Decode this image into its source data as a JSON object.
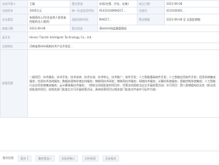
{
  "table": {
    "labels": {
      "name": "法定代表人",
      "status": "登记状态",
      "reg_capital": "注册资本",
      "date": "成立日期",
      "credit_code": "统一社会信用代码",
      "reg_no": "注册号",
      "org_code": "组织机构代码",
      "type": "企业类型",
      "term": "营业期限",
      "audit": "核准日期",
      "region": "登记机关",
      "english": "英文名",
      "address": "注册地址",
      "scope": "经营范围"
    },
    "values": {
      "name": "王磊",
      "status": "存续(在营、开业、在册)",
      "reg_capital": "3000万元",
      "date": "2023-09-08",
      "credit_code": "91410100MAD1T...",
      "reg_no": "410100000...",
      "org_code": "MAD1T...",
      "type": "有限责任公司(非自然人投资或控股的法人独资)",
      "term": "2023-09-08 至 无固定期限",
      "audit": "2023-09-08",
      "region": "郑州市市场监督管理局",
      "english": "Henan Tianzhi Intelligent Technology Co., Ltd.",
      "address": "河南省郑州市高新技术产业开发区...",
      "scope": "一般项目：技术服务、技术开发、技术咨询、技术交流、技术转让、技术推广；软件开发；人工智能基础软件开发；人工智能应用软件开发；信息系统集成服务；信息技术咨询服务；数据处理和存储支持服务；物联网技术研发；物联网技术服务；网络技术服务；计算机系统服务；智能控制系统集成；人工智能行业应用系统集成服务；云计算装备技术服务；（除依法须经批准的项目外，凭营业执照依法自主开展经营活动）许可项目：第二类增值电信业务（依法须经批准的项目，经相关部门批准后方可开展经营活动，具体经营项目以相关部门批准文件或许可证件为准）"
    }
  },
  "bottom": {
    "label": "股东信息",
    "items": [
      "股东 1",
      "最终受益人",
      "实际控制人",
      "对外投资",
      "历史股东"
    ]
  },
  "colors": {
    "accent": "#2f7de1",
    "label_bg": "#f2f6fb",
    "border": "#e3e7ee"
  }
}
